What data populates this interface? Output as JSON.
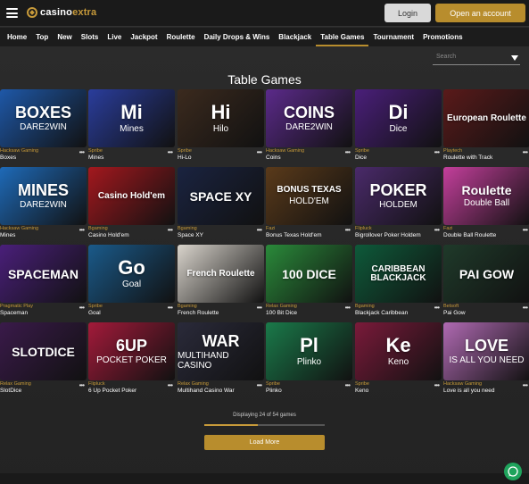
{
  "header": {
    "logo_part1": "casino",
    "logo_part2": "extra",
    "login_label": "Login",
    "open_account_label": "Open an account"
  },
  "nav": [
    "Home",
    "Top",
    "New",
    "Slots",
    "Live",
    "Jackpot",
    "Roulette",
    "Daily Drops & Wins",
    "Blackjack",
    "Table Games",
    "Tournament",
    "Promotions"
  ],
  "nav_active": "Table Games",
  "search": {
    "placeholder": "Search"
  },
  "page_title": "Table Games",
  "games": [
    {
      "provider": "Hacksaw Gaming",
      "name": "Boxes",
      "art": "BOXES",
      "art_sub": "DARE2WIN",
      "bg": "#1e58a8"
    },
    {
      "provider": "Spribe",
      "name": "Mines",
      "art": "Mi",
      "art_sub": "Mines",
      "bg": "#2a3d9c"
    },
    {
      "provider": "Spribe",
      "name": "Hi-Lo",
      "art": "Hi",
      "art_sub": "Hilo",
      "bg": "#3b2a1e"
    },
    {
      "provider": "Hacksaw Gaming",
      "name": "Coins",
      "art": "COINS",
      "art_sub": "DARE2WIN",
      "bg": "#5b2a8a"
    },
    {
      "provider": "Spribe",
      "name": "Dice",
      "art": "Di",
      "art_sub": "Dice",
      "bg": "#4a1f7a"
    },
    {
      "provider": "Playtech",
      "name": "Roulette with Track",
      "art": "European Roulette",
      "art_sub": "",
      "bg": "#5a1a1a"
    },
    {
      "provider": "Hacksaw Gaming",
      "name": "Mines",
      "art": "MINES",
      "art_sub": "DARE2WIN",
      "bg": "#1e6ab8"
    },
    {
      "provider": "Bgaming",
      "name": "Casino Hold'em",
      "art": "Casino Hold'em",
      "art_sub": "",
      "bg": "#a3181e"
    },
    {
      "provider": "Bgaming",
      "name": "Space XY",
      "art": "SPACE XY",
      "art_sub": "",
      "bg": "#1a2340"
    },
    {
      "provider": "Fazi",
      "name": "Bonus Texas Hold'em",
      "art": "BONUS TEXAS",
      "art_sub": "HOLD'EM",
      "bg": "#5a3a1a"
    },
    {
      "provider": "Flipluck",
      "name": "Bigrollover Poker Holdem",
      "art": "POKER",
      "art_sub": "HOLDEM",
      "bg": "#4a2a6a"
    },
    {
      "provider": "Fazi",
      "name": "Double Ball Roulette",
      "art": "Roulette",
      "art_sub": "Double Ball",
      "bg": "#c43f9c"
    },
    {
      "provider": "Pragmatic Play",
      "name": "Spaceman",
      "art": "SPACEMAN",
      "art_sub": "",
      "bg": "#4a1f7a"
    },
    {
      "provider": "Spribe",
      "name": "Goal",
      "art": "Go",
      "art_sub": "Goal",
      "bg": "#1a5a8a"
    },
    {
      "provider": "Bgaming",
      "name": "French Roulette",
      "art": "French Roulette",
      "art_sub": "",
      "bg": "#d9d4cc"
    },
    {
      "provider": "Relax Gaming",
      "name": "100 Bit Dice",
      "art": "100 DICE",
      "art_sub": "",
      "bg": "#2a8a3a"
    },
    {
      "provider": "Bgaming",
      "name": "Blackjack Caribbean",
      "art": "CARIBBEAN BLACKJACK",
      "art_sub": "",
      "bg": "#0e5a3a"
    },
    {
      "provider": "Betsoft",
      "name": "Pai Gow",
      "art": "PAI GOW",
      "art_sub": "",
      "bg": "#1f3a2a"
    },
    {
      "provider": "Relax Gaming",
      "name": "SlotDice",
      "art": "SLOTDICE",
      "art_sub": "",
      "bg": "#3a1a4a"
    },
    {
      "provider": "Flipluck",
      "name": "6 Up Pocket Poker",
      "art": "6UP",
      "art_sub": "POCKET POKER",
      "bg": "#a31a3a"
    },
    {
      "provider": "Relax Gaming",
      "name": "Multihand Casino War",
      "art": "WAR",
      "art_sub": "MULTIHAND CASINO",
      "bg": "#2a2a3a"
    },
    {
      "provider": "Spribe",
      "name": "Plinko",
      "art": "Pl",
      "art_sub": "Plinko",
      "bg": "#1a7a4a"
    },
    {
      "provider": "Spribe",
      "name": "Keno",
      "art": "Ke",
      "art_sub": "Keno",
      "bg": "#7a1a3a"
    },
    {
      "provider": "Hacksaw Gaming",
      "name": "Love is all you need",
      "art": "LOVE",
      "art_sub": "IS ALL YOU NEED",
      "bg": "#b06ab3"
    }
  ],
  "pagination": {
    "text": "Displaying 24 of 54 games",
    "shown": 24,
    "total": 54,
    "load_more_label": "Load More"
  }
}
